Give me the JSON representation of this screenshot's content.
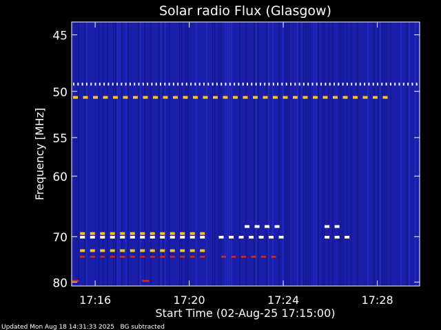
{
  "chart_data": {
    "type": "heatmap",
    "title": "Solar radio Flux (Glasgow)",
    "xlabel": "Start Time (02-Aug-25 17:15:00)",
    "ylabel": "Frequency [MHz]",
    "footer": "Updated Mon Aug 18 14:31:33 2025   BG subtracted",
    "x_unit": "minutes after 17:15:00",
    "xlim": [
      0.0,
      14.8
    ],
    "ylim": [
      44.0,
      81.0
    ],
    "y_scale": "reciprocal",
    "x_ticks": [
      {
        "t": 1.0,
        "label": "17:16"
      },
      {
        "t": 5.0,
        "label": "17:20"
      },
      {
        "t": 9.0,
        "label": "17:24"
      },
      {
        "t": 13.0,
        "label": "17:28"
      }
    ],
    "y_ticks": [
      {
        "f": 45,
        "label": "45"
      },
      {
        "f": 50,
        "label": "50"
      },
      {
        "f": 55,
        "label": "55"
      },
      {
        "f": 60,
        "label": "60"
      },
      {
        "f": 70,
        "label": "70"
      },
      {
        "f": 80,
        "label": "80"
      }
    ],
    "colors": {
      "background": "#1a1ea8",
      "stripe_dark": "#12168a",
      "stripe_light": "#2a34d0",
      "emission_high": "#ffffff",
      "emission_mid": "#ffc21a",
      "emission_low": "#e02a10"
    },
    "emission_bands": [
      {
        "f": 49.3,
        "t_start": 0.0,
        "t_end": 14.8,
        "intensity": "high",
        "pattern": "dotted"
      },
      {
        "f": 50.6,
        "t_start": 0.0,
        "t_end": 13.6,
        "intensity": "mid",
        "pattern": "dashed"
      },
      {
        "f": 69.4,
        "t_start": 0.3,
        "t_end": 5.5,
        "intensity": "mid",
        "pattern": "dashed"
      },
      {
        "f": 70.1,
        "t_start": 0.3,
        "t_end": 5.5,
        "intensity": "high",
        "pattern": "dashed"
      },
      {
        "f": 70.1,
        "t_start": 6.2,
        "t_end": 8.9,
        "intensity": "high",
        "pattern": "dashed"
      },
      {
        "f": 68.1,
        "t_start": 7.3,
        "t_end": 8.9,
        "intensity": "high",
        "pattern": "dashed"
      },
      {
        "f": 68.1,
        "t_start": 10.7,
        "t_end": 11.6,
        "intensity": "high",
        "pattern": "dashed"
      },
      {
        "f": 70.1,
        "t_start": 10.7,
        "t_end": 11.8,
        "intensity": "high",
        "pattern": "dashed"
      },
      {
        "f": 72.8,
        "t_start": 0.3,
        "t_end": 5.5,
        "intensity": "mid",
        "pattern": "dashed"
      },
      {
        "f": 74.1,
        "t_start": 0.3,
        "t_end": 5.5,
        "intensity": "low",
        "pattern": "dashed"
      },
      {
        "f": 74.1,
        "t_start": 6.3,
        "t_end": 8.9,
        "intensity": "low",
        "pattern": "dashed"
      },
      {
        "f": 79.7,
        "t_start": 0.0,
        "t_end": 0.3,
        "intensity": "low",
        "pattern": "solid"
      },
      {
        "f": 79.7,
        "t_start": 3.0,
        "t_end": 3.3,
        "intensity": "low",
        "pattern": "solid"
      }
    ]
  }
}
